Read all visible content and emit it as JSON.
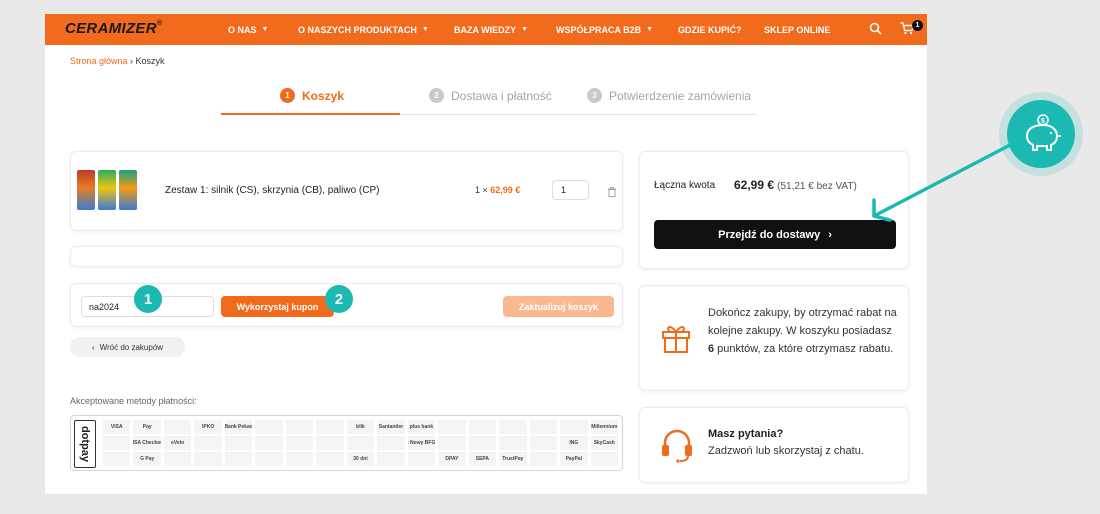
{
  "header": {
    "logo_main": "CERAMIZER",
    "logo_reg": "®",
    "nav": [
      {
        "label": "O NAS",
        "has_dropdown": true
      },
      {
        "label": "O NASZYCH PRODUKTACH",
        "has_dropdown": true
      },
      {
        "label": "BAZA WIEDZY",
        "has_dropdown": true
      },
      {
        "label": "WSPÓŁPRACA B2B",
        "has_dropdown": true
      },
      {
        "label": "GDZIE KUPIĆ?",
        "has_dropdown": false
      },
      {
        "label": "SKLEP ONLINE",
        "has_dropdown": false
      }
    ],
    "cart_count": "1",
    "icons": [
      "search-icon",
      "cart-icon"
    ]
  },
  "breadcrumb": {
    "home": "Strona główna",
    "separator": " › ",
    "current": "Koszyk"
  },
  "steps": [
    {
      "num": "1",
      "label": "Koszyk",
      "state": "active"
    },
    {
      "num": "2",
      "label": "Dostawa i płatność",
      "state": "inactive"
    },
    {
      "num": "3",
      "label": "Potwierdzenie zamówienia",
      "state": "inactive"
    }
  ],
  "cart": {
    "item": {
      "name": "Zestaw 1: silnik (CS), skrzynia (CB), paliwo (CP)",
      "qty_prefix": "1 ×",
      "price": "62,99 €",
      "quantity": "1"
    }
  },
  "coupon": {
    "value": "na2024",
    "apply_label": "Wykorzystaj kupon",
    "update_label": "Zaktualizuj koszyk",
    "markers": [
      "1",
      "2"
    ]
  },
  "back_label": "Wróć do zakupów",
  "payments": {
    "label": "Akceptowane metody płatności:",
    "provider": "dotpay",
    "logos": [
      "VISA",
      "Pay",
      "",
      "IPKO",
      "Bank Pekao",
      "",
      "",
      "",
      "blik",
      "Santander",
      "plus bank",
      "",
      "",
      "",
      "",
      "",
      "Millennium",
      "",
      "VISA Checkout",
      "eVelo",
      "",
      "",
      "",
      "",
      "",
      "",
      "",
      "Bank Nowy BFG S.A.",
      "",
      "",
      "",
      "",
      "ING",
      "SkyCash",
      "",
      "G Pay",
      "",
      "",
      "",
      "",
      "",
      "",
      "30 dni",
      "",
      "",
      "DPAY",
      "SEPA",
      "TrustPay",
      "",
      "PayPal",
      ""
    ]
  },
  "summary": {
    "total_label": "Łączna kwota",
    "total_value": "62,99 €",
    "total_net": "(51,21 € bez VAT)",
    "checkout_label": "Przejdź do dostawy"
  },
  "reward": {
    "text_before": "Dokończ zakupy, by otrzymać rabat na kolejne zakupy. W koszyku posiadasz ",
    "points": "6",
    "text_after": " punktów, za które otrzymasz rabatu."
  },
  "help": {
    "title": "Masz pytania?",
    "text": "Zadzwoń lub skorzystaj z chatu."
  },
  "colors": {
    "accent": "#f26a1b",
    "teal": "#1bb9b2",
    "dark": "#111111"
  }
}
